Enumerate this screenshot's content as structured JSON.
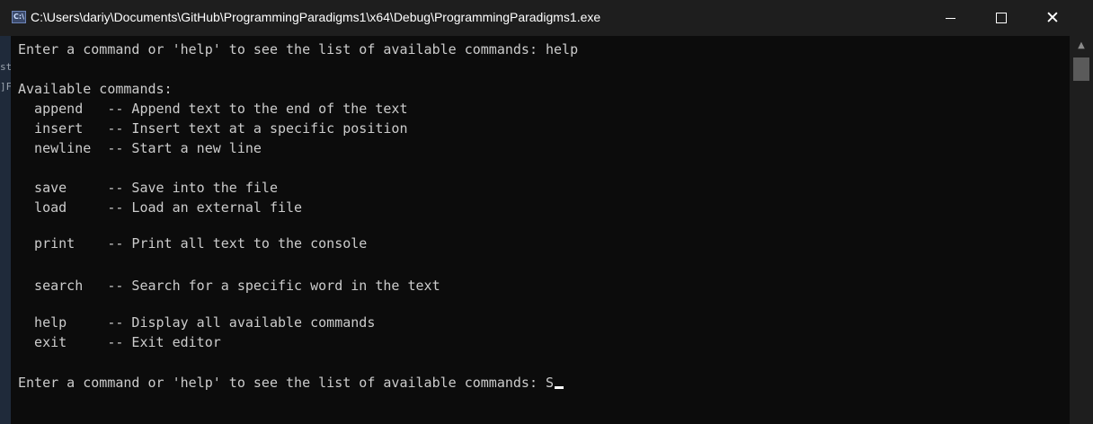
{
  "window": {
    "title": "C:\\Users\\dariy\\Documents\\GitHub\\ProgrammingParadigms1\\x64\\Debug\\ProgrammingParadigms1.exe",
    "icon": "console-app-icon",
    "minimize_icon": "minimize-icon",
    "maximize_icon": "maximize-icon",
    "close_label": "✕"
  },
  "background_fragments": [
    "st",
    "]F"
  ],
  "console": {
    "lines": [
      "Enter a command or 'help' to see the list of available commands: help",
      "",
      "Available commands:",
      "  append   -- Append text to the end of the text",
      "  insert   -- Insert text at a specific position",
      "  newline  -- Start a new line",
      "",
      "  save     -- Save into the file",
      "  load     -- Load an external file",
      "",
      "  print    -- Print all text to the console",
      "",
      "  search   -- Search for a specific word in the text",
      "",
      "  help     -- Display all available commands",
      "  exit     -- Exit editor",
      "",
      "Enter a command or 'help' to see the list of available commands: S"
    ]
  },
  "colors": {
    "console_bg": "#0c0c0c",
    "console_text": "#cccccc",
    "titlebar_bg": "#1e1e1e"
  }
}
